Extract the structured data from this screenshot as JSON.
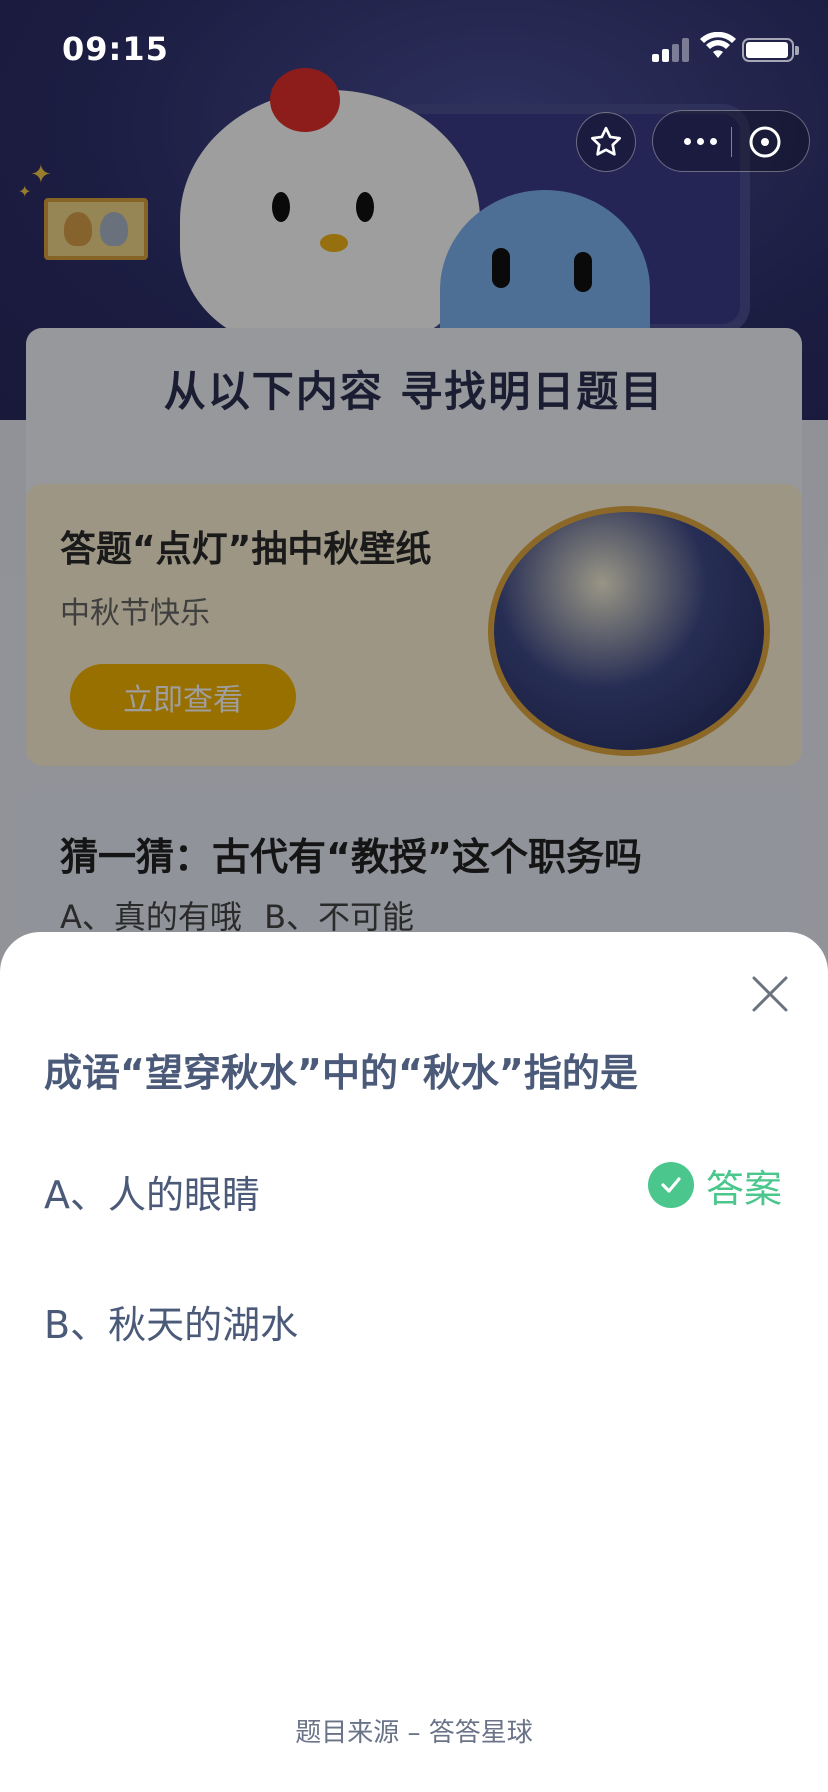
{
  "status_bar": {
    "time": "09:15"
  },
  "background": {
    "section_title": "从以下内容 寻找明日题目",
    "promo": {
      "title": "答题“点灯”抽中秋壁纸",
      "subtitle": "中秋节快乐",
      "button_label": "立即查看"
    },
    "guess": {
      "title": "猜一猜：古代有“教授”这个职务吗",
      "options": "A、真的有哦 B、不可能"
    }
  },
  "capsule": {
    "star_icon": "star-icon",
    "more_icon": "more-icon",
    "close_icon": "close-circle-icon"
  },
  "sheet": {
    "question": "成语“望穿秋水”中的“秋水”指的是",
    "options": [
      {
        "label": "A、人的眼睛",
        "is_answer": true
      },
      {
        "label": "B、秋天的湖水",
        "is_answer": false
      }
    ],
    "answer_label": "答案",
    "source": "题目来源 – 答答星球"
  },
  "colors": {
    "answer_green": "#4bc78d",
    "question_text": "#4b5a78",
    "promo_button": "#f6b500"
  }
}
